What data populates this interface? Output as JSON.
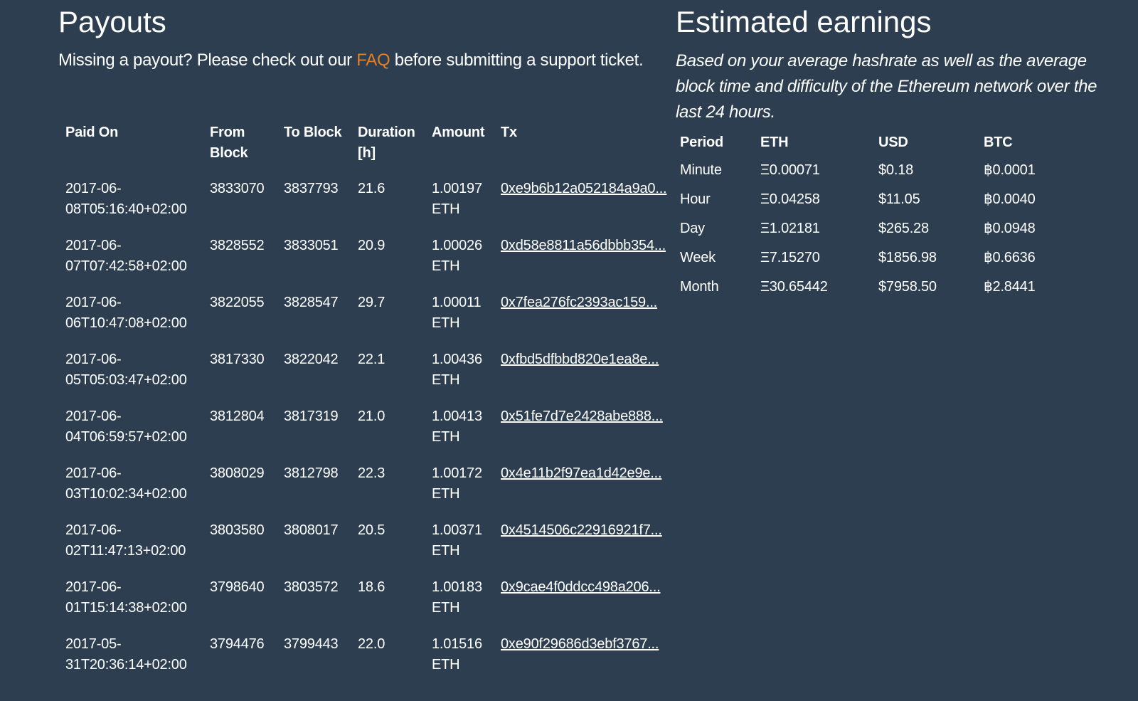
{
  "payouts": {
    "title": "Payouts",
    "intro_before": "Missing a payout? Please check out our ",
    "intro_link": "FAQ",
    "intro_after": " before submitting a support ticket.",
    "columns": [
      "Paid On",
      "From Block",
      "To Block",
      "Duration [h]",
      "Amount",
      "Tx"
    ],
    "rows": [
      {
        "paid_on": "2017-06-08T05:16:40+02:00",
        "from": "3833070",
        "to": "3837793",
        "duration": "21.6",
        "amount": "1.00197 ETH",
        "tx": "0xe9b6b12a052184a9a0..."
      },
      {
        "paid_on": "2017-06-07T07:42:58+02:00",
        "from": "3828552",
        "to": "3833051",
        "duration": "20.9",
        "amount": "1.00026 ETH",
        "tx": "0xd58e8811a56dbbb354..."
      },
      {
        "paid_on": "2017-06-06T10:47:08+02:00",
        "from": "3822055",
        "to": "3828547",
        "duration": "29.7",
        "amount": "1.00011 ETH",
        "tx": "0x7fea276fc2393ac159..."
      },
      {
        "paid_on": "2017-06-05T05:03:47+02:00",
        "from": "3817330",
        "to": "3822042",
        "duration": "22.1",
        "amount": "1.00436 ETH",
        "tx": "0xfbd5dfbbd820e1ea8e..."
      },
      {
        "paid_on": "2017-06-04T06:59:57+02:00",
        "from": "3812804",
        "to": "3817319",
        "duration": "21.0",
        "amount": "1.00413 ETH",
        "tx": "0x51fe7d7e2428abe888..."
      },
      {
        "paid_on": "2017-06-03T10:02:34+02:00",
        "from": "3808029",
        "to": "3812798",
        "duration": "22.3",
        "amount": "1.00172 ETH",
        "tx": "0x4e11b2f97ea1d42e9e..."
      },
      {
        "paid_on": "2017-06-02T11:47:13+02:00",
        "from": "3803580",
        "to": "3808017",
        "duration": "20.5",
        "amount": "1.00371 ETH",
        "tx": "0x4514506c22916921f7..."
      },
      {
        "paid_on": "2017-06-01T15:14:38+02:00",
        "from": "3798640",
        "to": "3803572",
        "duration": "18.6",
        "amount": "1.00183 ETH",
        "tx": "0x9cae4f0ddcc498a206..."
      },
      {
        "paid_on": "2017-05-31T20:36:14+02:00",
        "from": "3794476",
        "to": "3799443",
        "duration": "22.0",
        "amount": "1.01516 ETH",
        "tx": "0xe90f29686d3ebf3767..."
      }
    ]
  },
  "estimates": {
    "title": "Estimated earnings",
    "note": "Based on your average hashrate as well as the average block time and difficulty of the Ethereum network over the last 24 hours.",
    "columns": [
      "Period",
      "ETH",
      "USD",
      "BTC"
    ],
    "rows": [
      {
        "period": "Minute",
        "eth": "Ξ0.00071",
        "usd": "$0.18",
        "btc": "฿0.0001"
      },
      {
        "period": "Hour",
        "eth": "Ξ0.04258",
        "usd": "$11.05",
        "btc": "฿0.0040"
      },
      {
        "period": "Day",
        "eth": "Ξ1.02181",
        "usd": "$265.28",
        "btc": "฿0.0948"
      },
      {
        "period": "Week",
        "eth": "Ξ7.15270",
        "usd": "$1856.98",
        "btc": "฿0.6636"
      },
      {
        "period": "Month",
        "eth": "Ξ30.65442",
        "usd": "$7958.50",
        "btc": "฿2.8441"
      }
    ]
  },
  "colors": {
    "background": "#2c3e50",
    "link_accent": "#e67e22",
    "text": "#ffffff"
  }
}
